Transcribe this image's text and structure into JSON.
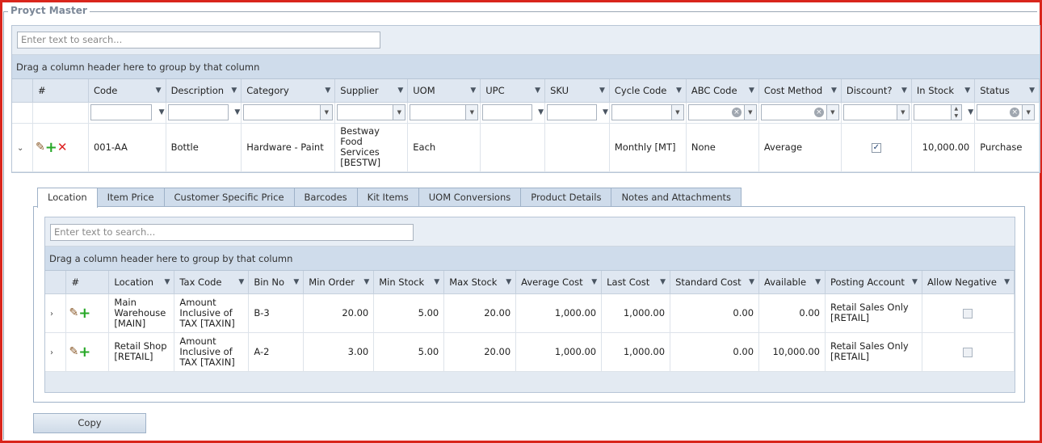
{
  "title": "Proуct Master",
  "main_grid": {
    "search_placeholder": "Enter text to search...",
    "group_hint": "Drag a column header here to group by that column",
    "columns": [
      "#",
      "Code",
      "Description",
      "Category",
      "Supplier",
      "UOM",
      "UPC",
      "SKU",
      "Cycle Code",
      "ABC Code",
      "Cost Method",
      "Discount?",
      "In Stock",
      "Status"
    ],
    "row": {
      "code": "001-AA",
      "description": "Bottle",
      "category": "Hardware - Paint",
      "supplier": "Bestway Food Services [BESTW]",
      "uom": "Each",
      "upc": "",
      "sku": "",
      "cycle_code": "Monthly [MT]",
      "abc_code": "None",
      "cost_method": "Average",
      "discount": true,
      "in_stock": "10,000.00",
      "status": "Purchase"
    }
  },
  "tabs": [
    "Location",
    "Item Price",
    "Customer Specific Price",
    "Barcodes",
    "Kit Items",
    "UOM Conversions",
    "Product Details",
    "Notes and Attachments"
  ],
  "active_tab": "Location",
  "location_grid": {
    "search_placeholder": "Enter text to search...",
    "group_hint": "Drag a column header here to group by that column",
    "columns": [
      "#",
      "Location",
      "Tax Code",
      "Bin No",
      "Min Order",
      "Min Stock",
      "Max Stock",
      "Average Cost",
      "Last Cost",
      "Standard Cost",
      "Available",
      "Posting Account",
      "Allow Negative"
    ],
    "rows": [
      {
        "location": "Main Warehouse [MAIN]",
        "tax_code": "Amount Inclusive of TAX [TAXIN]",
        "bin_no": "B-3",
        "min_order": "20.00",
        "min_stock": "5.00",
        "max_stock": "20.00",
        "average_cost": "1,000.00",
        "last_cost": "1,000.00",
        "standard_cost": "0.00",
        "available": "0.00",
        "posting_account": "Retail Sales Only [RETAIL]",
        "allow_negative": false
      },
      {
        "location": "Retail Shop [RETAIL]",
        "tax_code": "Amount Inclusive of TAX [TAXIN]",
        "bin_no": "A-2",
        "min_order": "3.00",
        "min_stock": "5.00",
        "max_stock": "20.00",
        "average_cost": "1,000.00",
        "last_cost": "1,000.00",
        "standard_cost": "0.00",
        "available": "10,000.00",
        "posting_account": "Retail Sales Only [RETAIL]",
        "allow_negative": false
      }
    ]
  },
  "copy_button": "Copy"
}
